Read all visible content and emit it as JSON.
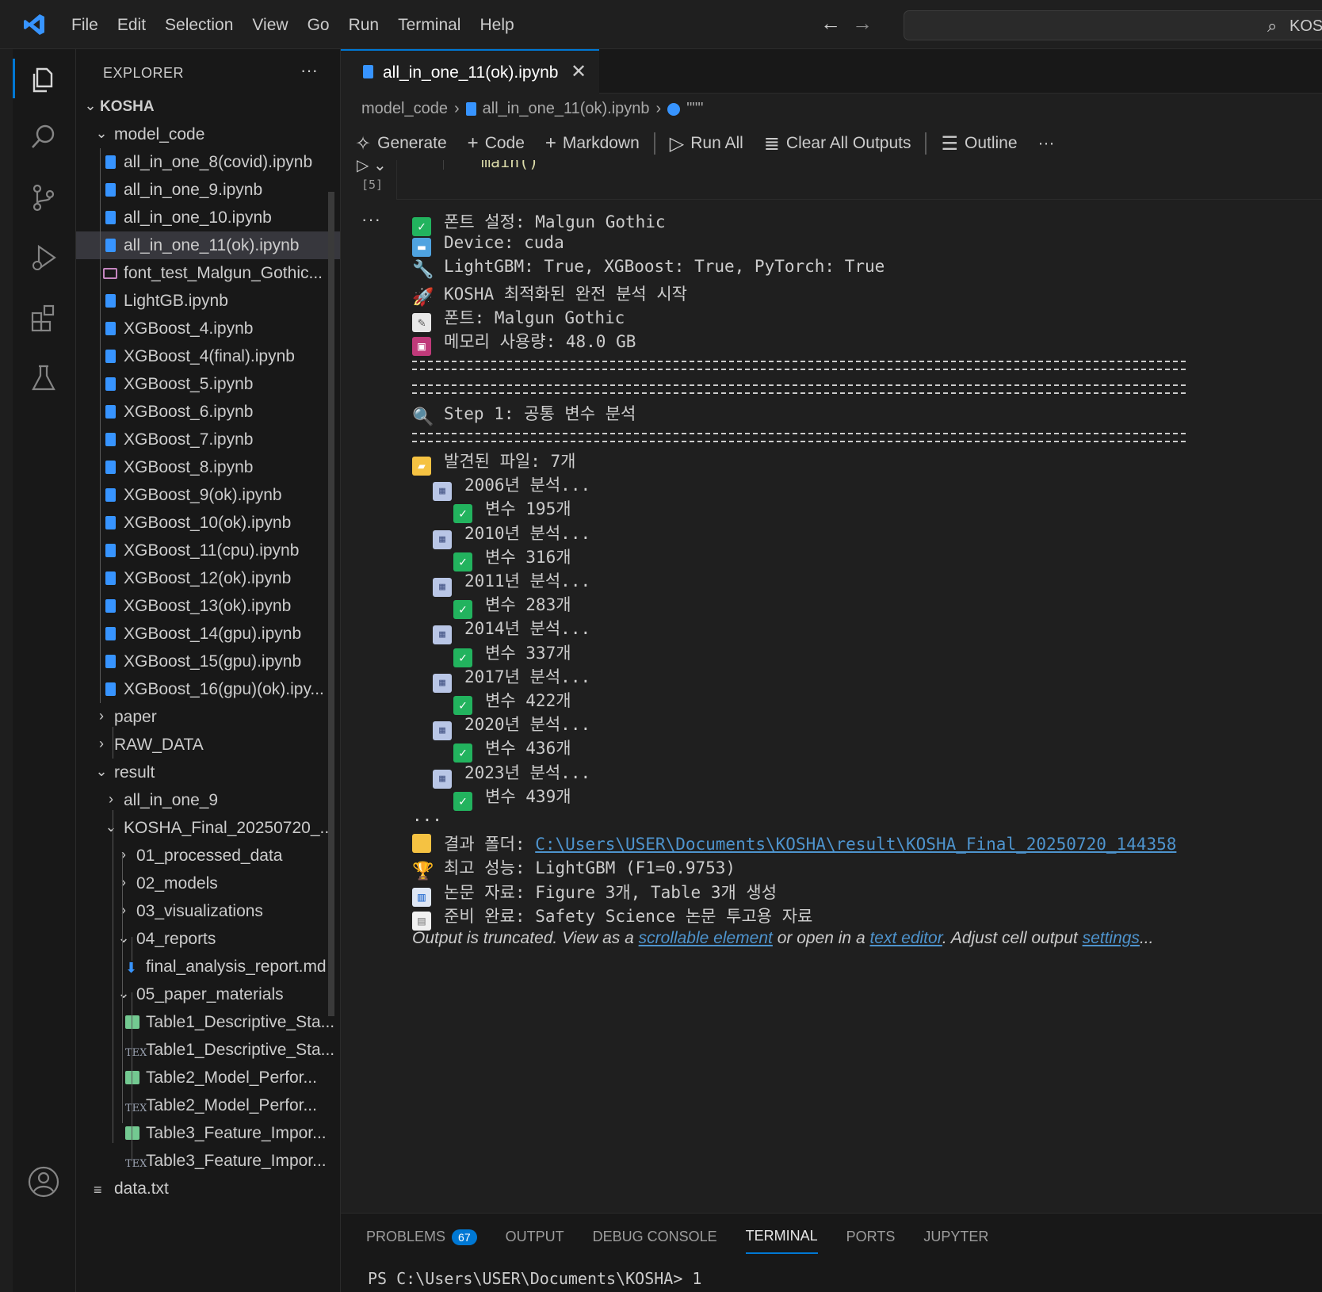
{
  "menubar": [
    "File",
    "Edit",
    "Selection",
    "View",
    "Go",
    "Run",
    "Terminal",
    "Help"
  ],
  "search": {
    "text": "KOS"
  },
  "explorer": {
    "title": "EXPLORER",
    "root": "KOSHA",
    "rows": [
      {
        "label": "model_code",
        "kind": "folder-open",
        "depth": 1
      },
      {
        "label": "all_in_one_8(covid).ipynb",
        "kind": "nb",
        "depth": 2
      },
      {
        "label": "all_in_one_9.ipynb",
        "kind": "nb",
        "depth": 2
      },
      {
        "label": "all_in_one_10.ipynb",
        "kind": "nb",
        "depth": 2
      },
      {
        "label": "all_in_one_11(ok).ipynb",
        "kind": "nb",
        "depth": 2,
        "selected": true
      },
      {
        "label": "font_test_Malgun_Gothic...",
        "kind": "img",
        "depth": 2
      },
      {
        "label": "LightGB.ipynb",
        "kind": "nb",
        "depth": 2
      },
      {
        "label": "XGBoost_4.ipynb",
        "kind": "nb",
        "depth": 2
      },
      {
        "label": "XGBoost_4(final).ipynb",
        "kind": "nb",
        "depth": 2
      },
      {
        "label": "XGBoost_5.ipynb",
        "kind": "nb",
        "depth": 2
      },
      {
        "label": "XGBoost_6.ipynb",
        "kind": "nb",
        "depth": 2
      },
      {
        "label": "XGBoost_7.ipynb",
        "kind": "nb",
        "depth": 2
      },
      {
        "label": "XGBoost_8.ipynb",
        "kind": "nb",
        "depth": 2
      },
      {
        "label": "XGBoost_9(ok).ipynb",
        "kind": "nb",
        "depth": 2
      },
      {
        "label": "XGBoost_10(ok).ipynb",
        "kind": "nb",
        "depth": 2
      },
      {
        "label": "XGBoost_11(cpu).ipynb",
        "kind": "nb",
        "depth": 2
      },
      {
        "label": "XGBoost_12(ok).ipynb",
        "kind": "nb",
        "depth": 2
      },
      {
        "label": "XGBoost_13(ok).ipynb",
        "kind": "nb",
        "depth": 2
      },
      {
        "label": "XGBoost_14(gpu).ipynb",
        "kind": "nb",
        "depth": 2
      },
      {
        "label": "XGBoost_15(gpu).ipynb",
        "kind": "nb",
        "depth": 2
      },
      {
        "label": "XGBoost_16(gpu)(ok).ipy...",
        "kind": "nb",
        "depth": 2
      },
      {
        "label": "paper",
        "kind": "folder-closed",
        "depth": 1
      },
      {
        "label": "RAW_DATA",
        "kind": "folder-closed",
        "depth": 1
      },
      {
        "label": "result",
        "kind": "folder-open",
        "depth": 1
      },
      {
        "label": "all_in_one_9",
        "kind": "folder-closed",
        "depth": 2
      },
      {
        "label": "KOSHA_Final_20250720_...",
        "kind": "folder-open",
        "depth": 2
      },
      {
        "label": "01_processed_data",
        "kind": "folder-closed",
        "depth": 3
      },
      {
        "label": "02_models",
        "kind": "folder-closed",
        "depth": 3
      },
      {
        "label": "03_visualizations",
        "kind": "folder-closed",
        "depth": 3
      },
      {
        "label": "04_reports",
        "kind": "folder-open",
        "depth": 3
      },
      {
        "label": "final_analysis_report.md",
        "kind": "md",
        "depth": 4
      },
      {
        "label": "05_paper_materials",
        "kind": "folder-open",
        "depth": 3
      },
      {
        "label": "Table1_Descriptive_Sta...",
        "kind": "tbl",
        "depth": 4
      },
      {
        "label": "Table1_Descriptive_Sta...",
        "kind": "tex",
        "depth": 4
      },
      {
        "label": "Table2_Model_Perfor...",
        "kind": "tbl",
        "depth": 4
      },
      {
        "label": "Table2_Model_Perfor...",
        "kind": "tex",
        "depth": 4
      },
      {
        "label": "Table3_Feature_Impor...",
        "kind": "tbl",
        "depth": 4
      },
      {
        "label": "Table3_Feature_Impor...",
        "kind": "tex",
        "depth": 4
      },
      {
        "label": "data.txt",
        "kind": "txt",
        "depth": 1
      }
    ],
    "tex_glyph": "TEX",
    "md_glyph": "⬇",
    "txt_glyph": "≡"
  },
  "tab": {
    "name": "all_in_one_11(ok).ipynb",
    "close_glyph": "✕"
  },
  "breadcrumb": [
    "model_code",
    "all_in_one_11(ok).ipynb",
    "\"\"\""
  ],
  "toolbar": {
    "generate": "Generate",
    "code": "Code",
    "markdown": "Markdown",
    "run_all": "Run All",
    "clear_outputs": "Clear All Outputs",
    "outline": "Outline",
    "more": "···"
  },
  "cell": {
    "code_snippet": "main()",
    "exec_count": "[5]",
    "output_dots": "···"
  },
  "output": {
    "lines": [
      {
        "icon": "check",
        "glyph": "✓",
        "text": "폰트 설정: Malgun Gothic"
      },
      {
        "icon": "laptop",
        "glyph": "▬",
        "text": "Device: cuda"
      },
      {
        "icon": "wrench",
        "glyph": "🔧",
        "text": "LightGBM: True, XGBoost: True, PyTorch: True"
      },
      {
        "icon": "rocket",
        "glyph": "🚀",
        "text": "KOSHA 최적화된 완전 분석 시작"
      },
      {
        "icon": "memo",
        "glyph": "✎",
        "text": "폰트: Malgun Gothic"
      },
      {
        "icon": "disk",
        "glyph": "▣",
        "text": "메모리 사용량: 48.0 GB"
      }
    ],
    "step_line": {
      "icon": "magnifier",
      "glyph": "🔍",
      "text": "Step 1: 공통 변수 분석"
    },
    "files_line": {
      "icon": "folder",
      "glyph": "▰",
      "text": "발견된 파일: 7개"
    },
    "years": [
      {
        "year": "2006년 분석...",
        "count": "변수 195개"
      },
      {
        "year": "2010년 분석...",
        "count": "변수 316개"
      },
      {
        "year": "2011년 분석...",
        "count": "변수 283개"
      },
      {
        "year": "2014년 분석...",
        "count": "변수 337개"
      },
      {
        "year": "2017년 분석...",
        "count": "변수 422개"
      },
      {
        "year": "2020년 분석...",
        "count": "변수 436개"
      },
      {
        "year": "2023년 분석...",
        "count": "변수 439개"
      }
    ],
    "ellipsis": "...",
    "result_label": "결과 폴더: ",
    "result_path": "C:\\Users\\USER\\Documents\\KOSHA\\result\\KOSHA_Final_20250720_144358",
    "best_line": "최고 성능: LightGBM (F1=0.9753)",
    "paper_line": "논문 자료: Figure 3개, Table 3개 생성",
    "ready_line": "준비 완료: Safety Science 논문 투고용 자료",
    "trunc_pre": "Output is truncated. View as a ",
    "trunc_link1": "scrollable element",
    "trunc_mid": " or open in a ",
    "trunc_link2": "text editor",
    "trunc_mid2": ". Adjust cell output ",
    "trunc_link3": "settings",
    "trunc_end": "..."
  },
  "panel": {
    "tabs": [
      {
        "label": "PROBLEMS",
        "badge": "67"
      },
      {
        "label": "OUTPUT"
      },
      {
        "label": "DEBUG CONSOLE"
      },
      {
        "label": "TERMINAL",
        "active": true
      },
      {
        "label": "PORTS"
      },
      {
        "label": "JUPYTER"
      }
    ],
    "terminal_line": "PS C:\\Users\\USER\\Documents\\KOSHA> 1"
  },
  "colors": {
    "accent": "#0078d4",
    "notebook_icon": "#3794ff",
    "link": "#4e94ce",
    "check": "#22b35e"
  }
}
